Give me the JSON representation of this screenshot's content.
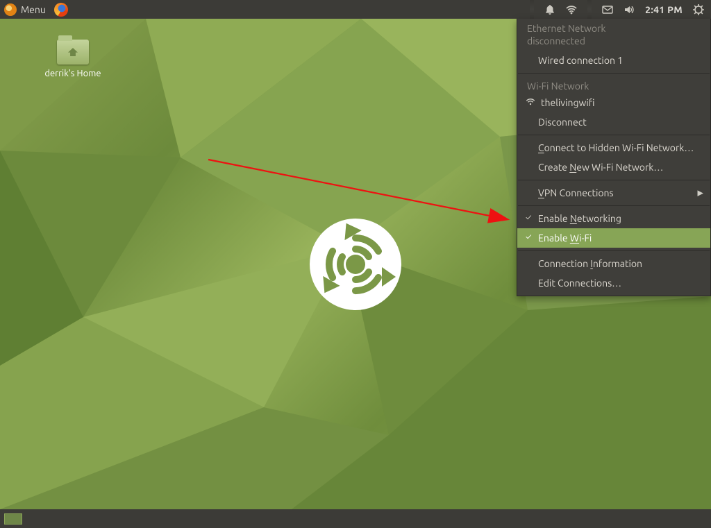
{
  "panel": {
    "menu_label": "Menu",
    "clock": "2:41 PM"
  },
  "desktop_icon": {
    "label": "derrik's Home"
  },
  "network_menu": {
    "ethernet_header": "Ethernet Network",
    "ethernet_status": "disconnected",
    "wired_item": "Wired connection 1",
    "wifi_header": "Wi-Fi Network",
    "wifi_ssid": "thelivingwifi",
    "disconnect": "Disconnect",
    "hidden_prefix": "C",
    "hidden_rest": "onnect to Hidden Wi-Fi Network…",
    "create_prefix": "Create ",
    "create_u": "N",
    "create_rest": "ew Wi-Fi Network…",
    "vpn_u": "V",
    "vpn_rest": "PN Connections",
    "enable_net_prefix": "Enable ",
    "enable_net_u": "N",
    "enable_net_rest": "etworking",
    "enable_wifi_prefix": "Enable ",
    "enable_wifi_u": "W",
    "enable_wifi_rest": "i-Fi",
    "conn_info_prefix": "Connection ",
    "conn_info_u": "I",
    "conn_info_rest": "nformation",
    "edit_conn": "Edit Connections…"
  }
}
